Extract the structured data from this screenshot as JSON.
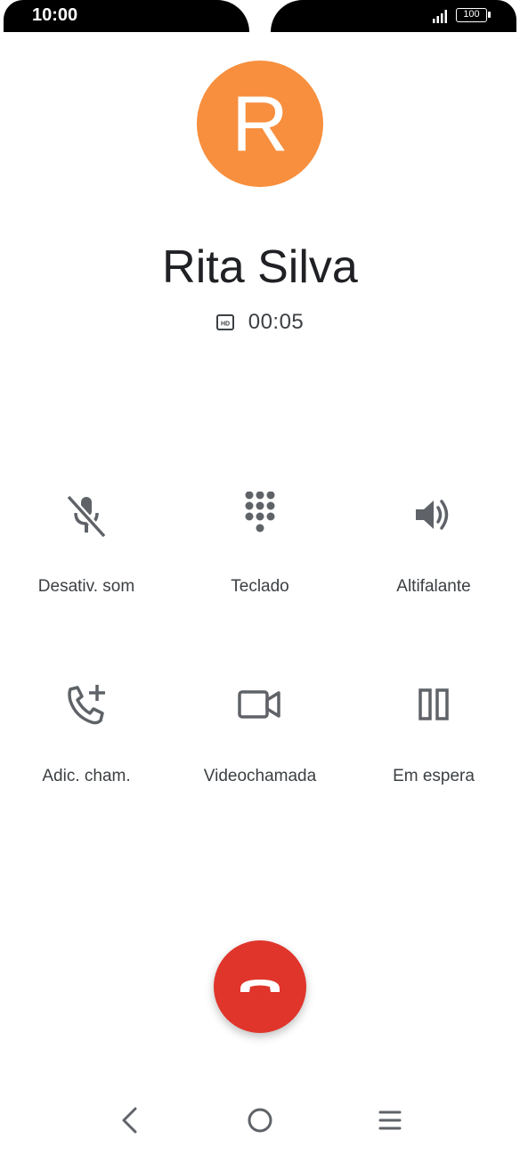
{
  "status_bar": {
    "time": "10:00",
    "battery": "100",
    "signal_icon": "signal-bars-icon"
  },
  "contact": {
    "initial": "R",
    "name": "Rita Silva",
    "avatar_color": "#f78f3e"
  },
  "call": {
    "hd_icon": "hd-icon",
    "duration": "00:05"
  },
  "controls": [
    {
      "label": "Desativ. som",
      "icon": "mic-off-icon"
    },
    {
      "label": "Teclado",
      "icon": "dialpad-icon"
    },
    {
      "label": "Altifalante",
      "icon": "speaker-icon"
    },
    {
      "label": "Adic. cham.",
      "icon": "add-call-icon"
    },
    {
      "label": "Videochamada",
      "icon": "videocam-icon"
    },
    {
      "label": "Em espera",
      "icon": "pause-icon"
    }
  ],
  "end_call": {
    "icon": "end-call-icon",
    "color": "#e0352b"
  },
  "nav": {
    "back_icon": "back-icon",
    "home_icon": "home-icon",
    "recents_icon": "menu-icon"
  }
}
